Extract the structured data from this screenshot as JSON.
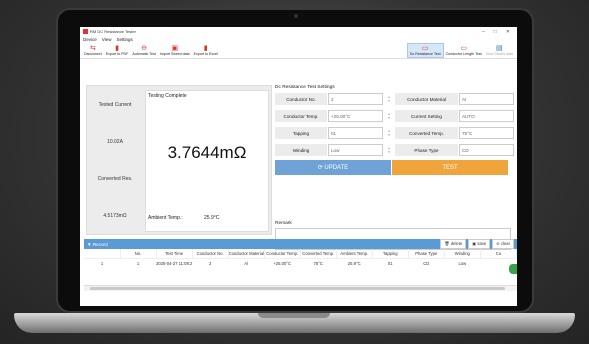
{
  "window": {
    "title": "RM DC Resistance Tester",
    "controls": [
      "–",
      "□",
      "✕"
    ]
  },
  "menu": [
    "Device",
    "View",
    "Settings"
  ],
  "toolbar": [
    {
      "label": "Disconnect",
      "icon": "plug-icon",
      "glyph": "⇆",
      "state": "normal"
    },
    {
      "label": "Export to PDF",
      "icon": "pdf-icon",
      "glyph": "▮",
      "state": "normal"
    },
    {
      "label": "Automatic Test",
      "icon": "auto-test-icon",
      "glyph": "⊖",
      "state": "normal"
    },
    {
      "label": "Import Stored data",
      "icon": "import-icon",
      "glyph": "▣",
      "state": "normal"
    },
    {
      "label": "Export to Excel",
      "icon": "excel-icon",
      "glyph": "▮",
      "state": "normal"
    },
    {
      "label": "Dc Resistance Test",
      "icon": "dc-resistance-icon",
      "glyph": "▭",
      "state": "selected"
    },
    {
      "label": "Conductor Length Test",
      "icon": "length-test-icon",
      "glyph": "▭",
      "state": "normal"
    },
    {
      "label": "View Stored data",
      "icon": "stored-data-icon",
      "glyph": "▤",
      "state": "disabled"
    }
  ],
  "left": {
    "tested_current_label": "Tested Current",
    "tested_current_value": "10.02A",
    "converted_res_label": "Converted Res.",
    "converted_res_value": "4.5173mΩ",
    "status": "Testing Complete",
    "resistance": "3.7644mΩ",
    "ambient_label": "Ambient Temp.:",
    "ambient_value": "25.9°C"
  },
  "settings": {
    "title": "Dc Resistance Test Settings",
    "rows": [
      {
        "l1": "Conductor No.",
        "v1": "2",
        "l2": "Conductor Material",
        "v2": "Al"
      },
      {
        "l1": "Conductor Temp.",
        "v1": "+25.00°C",
        "l2": "Current Setting",
        "v2": "AUTO"
      },
      {
        "l1": "Tapping",
        "v1": "01",
        "l2": "Converted Temp.",
        "v2": "75°C"
      },
      {
        "l1": "Winding",
        "v1": "Low",
        "l2": "Phase Type",
        "v2": "CD"
      }
    ],
    "update_label": "UPDATE",
    "test_label": "TEST"
  },
  "remark": {
    "label": "Remark"
  },
  "record": {
    "title": "Record",
    "buttons": [
      "delete",
      "save",
      "clear"
    ],
    "columns": [
      "",
      "No.",
      "Test Time",
      "Conductor No.",
      "Conductor Material",
      "Conductor Temp.",
      "Converted Temp.",
      "Ambient Temp.",
      "Tapping",
      "Phase Type",
      "Winding",
      "Cu"
    ],
    "rows": [
      [
        "1",
        "1",
        "2025-04-27 11:09:29",
        "2",
        "Al",
        "+25.00°C",
        "75°C",
        "25.9°C",
        "01",
        "CD",
        "Low",
        ""
      ]
    ]
  }
}
